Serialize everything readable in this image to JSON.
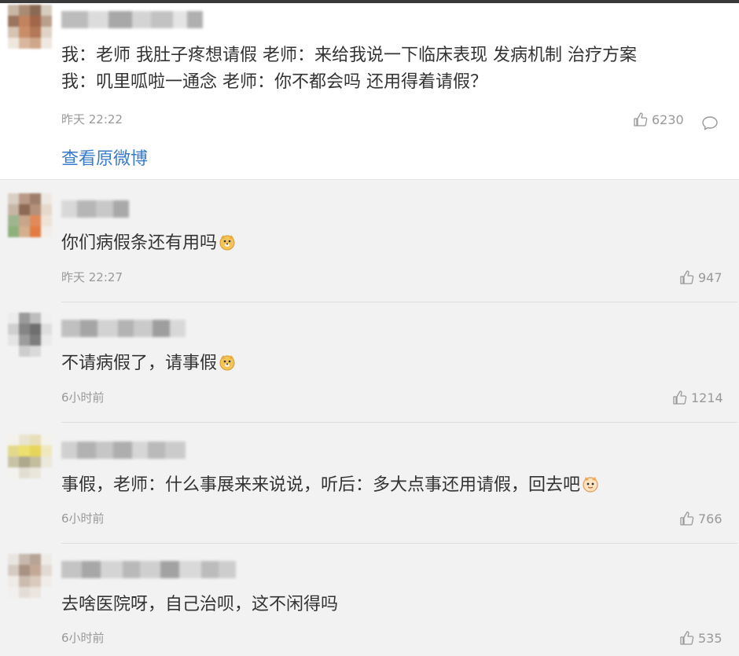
{
  "main_post": {
    "line1": "我：老师 我肚子疼想请假 老师：来给我说一下临床表现 发病机制 治疗方案",
    "line2": "我：叽里呱啦一通念 老师：你不都会吗 还用得着请假？",
    "time": "昨天 22:22",
    "likes": "6230",
    "view_original": "查看原微博"
  },
  "comments": [
    {
      "text": "你们病假条还有用吗",
      "time": "昨天 22:27",
      "likes": "947",
      "emoji": "doge-emoji"
    },
    {
      "text": "不请病假了，请事假",
      "time": "6小时前",
      "likes": "1214",
      "emoji": "doge-emoji"
    },
    {
      "text": "事假，老师：什么事展来来说说，听后：多大点事还用请假，回去吧",
      "time": "6小时前",
      "likes": "766",
      "emoji": "cat-emoji"
    },
    {
      "text": "去啥医院呀，自己治呗，这不闲得吗",
      "time": "6小时前",
      "likes": "535",
      "emoji": ""
    }
  ],
  "colors": {
    "link": "#3a7bc8",
    "meta": "#999999",
    "text": "#333333",
    "background": "#f2f2f2"
  }
}
